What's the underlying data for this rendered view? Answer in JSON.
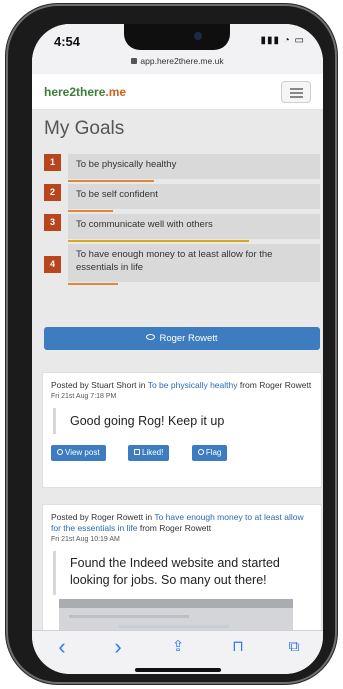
{
  "status": {
    "time": "4:54",
    "icons": "▮▮▮ ◔ ▭"
  },
  "url": {
    "text": "app.here2there.me.uk"
  },
  "brand": {
    "part1": "here2there",
    "part2": ".me"
  },
  "page": {
    "title": "My Goals"
  },
  "goals": [
    {
      "num": "1",
      "text": "To be physically healthy",
      "bar_color": "#e0873e",
      "bar_fraction": 0.34
    },
    {
      "num": "2",
      "text": "To be self confident",
      "bar_color": "#e0873e",
      "bar_fraction": 0.18
    },
    {
      "num": "3",
      "text": "To communicate well with others",
      "bar_color": "#d9a81a",
      "bar_fraction": 0.72
    },
    {
      "num": "4",
      "text": "To have enough money to at least allow for the essentials in life",
      "bar_color": "#e0873e",
      "bar_fraction": 0.2
    }
  ],
  "user_button": {
    "label": "Roger Rowett"
  },
  "posts": [
    {
      "prefix": "Posted by Stuart Short in ",
      "goal_link": "To be physically healthy",
      "suffix": " from Roger Rowett",
      "date": "Fri 21st Aug 7:18 PM",
      "body": "Good going Rog! Keep it up",
      "actions": {
        "view": "View post",
        "liked": "Liked!",
        "flag": "Flag"
      }
    },
    {
      "prefix": "Posted by Roger Rowett in ",
      "goal_link": "To have enough money to at least allow for the essentials in life",
      "suffix": " from Roger Rowett",
      "date": "Fri 21st Aug 10:19 AM",
      "body": "Found the Indeed website and started looking for jobs. So many out there!"
    }
  ],
  "toolbar": {
    "back": "‹",
    "forward": "›",
    "share": "⇪",
    "bookmarks": "⊓",
    "tabs": "⧉"
  },
  "colors": {
    "accent": "#3d7cbf",
    "goal_number": "#b8451b",
    "brand_green": "#3c7d3a",
    "brand_orange": "#d0621a",
    "safari_blue": "#2e7bf6"
  }
}
